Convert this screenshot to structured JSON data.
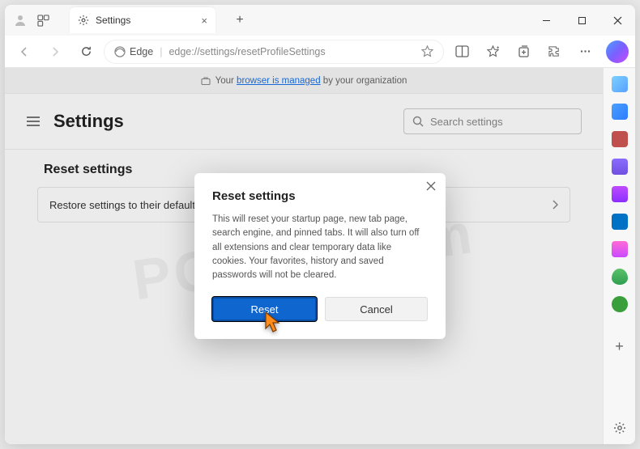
{
  "titlebar": {
    "tab_label": "Settings",
    "tab_close": "×",
    "newtab": "+",
    "min": "—",
    "max": "▢",
    "close": "×"
  },
  "toolbar": {
    "edge_label": "Edge",
    "url_sep": "|",
    "url": "edge://settings/resetProfileSettings"
  },
  "managed": {
    "prefix": "Your ",
    "link": "browser is managed",
    "suffix": " by your organization"
  },
  "settings": {
    "title": "Settings",
    "search_placeholder": "Search settings",
    "section": "Reset settings",
    "row": "Restore settings to their default values"
  },
  "dialog": {
    "title": "Reset settings",
    "body": "This will reset your startup page, new tab page, search engine, and pinned tabs. It will also turn off all extensions and clear temporary data like cookies. Your favorites, history and saved passwords will not be cleared.",
    "reset": "Reset",
    "cancel": "Cancel"
  },
  "watermark": "PCrisk.com"
}
